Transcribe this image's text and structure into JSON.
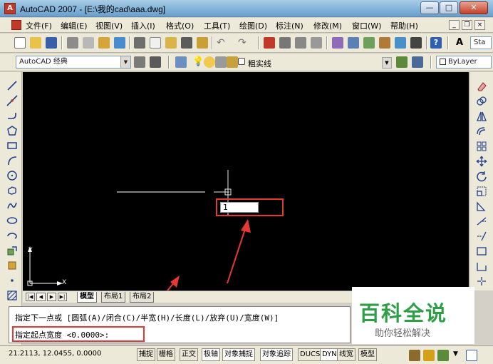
{
  "window": {
    "title": "AutoCAD 2007 - [E:\\我的cad\\aaa.dwg]",
    "minimize": "—",
    "maximize": "□",
    "close": "✕"
  },
  "menu": [
    "文件(F)",
    "编辑(E)",
    "视图(V)",
    "插入(I)",
    "格式(O)",
    "工具(T)",
    "绘图(D)",
    "标注(N)",
    "修改(M)",
    "窗口(W)",
    "帮助(H)"
  ],
  "mdi": {
    "minimize": "_",
    "restore": "❐",
    "close": "×"
  },
  "toolbar": {
    "text_style": "Sta"
  },
  "workspace": {
    "value": "AutoCAD 经典"
  },
  "layer": {
    "value": "粗实线"
  },
  "color": {
    "value": "ByLayer"
  },
  "ucs": {
    "y": "Y",
    "x": "X"
  },
  "dyn_input": {
    "value": "1"
  },
  "tabs": {
    "model": "模型",
    "layout1": "布局1",
    "layout2": "布局2"
  },
  "command": {
    "line1": "指定下一点或 [圆弧(A)/闭合(C)/半宽(H)/长度(L)/放弃(U)/宽度(W)]",
    "line2": "指定起点宽度 <0.0000>:"
  },
  "status": {
    "coords": "21.2113, 12.0455, 0.0000",
    "buttons": [
      "捕捉",
      "栅格",
      "正交",
      "极轴",
      "对象捕捉",
      "对象追踪",
      "DUCS",
      "DYN",
      "线宽",
      "模型"
    ]
  },
  "watermark": {
    "title": "百科全说",
    "subtitle": "助你轻松解决"
  },
  "colors": {
    "accent_red": "#e53935",
    "watermark_green": "#2e9e47",
    "drawing_bg": "#000000"
  }
}
